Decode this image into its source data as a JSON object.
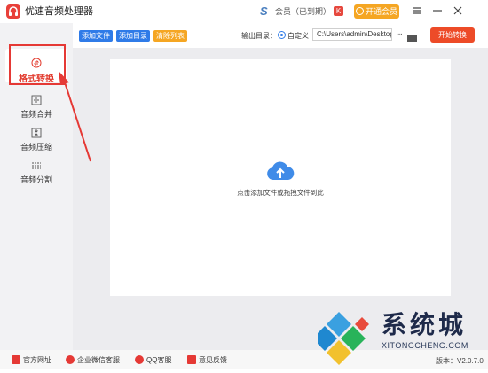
{
  "window": {
    "title": "优速音频处理器",
    "user_name": "会员（已到期）",
    "vip_button": "开通会员"
  },
  "sidebar": {
    "items": [
      {
        "label": "格式转换",
        "icon": "format-convert-icon",
        "active": true
      },
      {
        "label": "音频合并",
        "icon": "merge-icon",
        "active": false
      },
      {
        "label": "音频压缩",
        "icon": "compress-icon",
        "active": false
      },
      {
        "label": "音频分割",
        "icon": "split-icon",
        "active": false
      }
    ]
  },
  "toolbar": {
    "add_file": "添加文件",
    "add_folder": "添加目录",
    "clear_list": "清除列表",
    "output_label": "输出目录：",
    "custom_label": "自定义",
    "output_path": "C:\\Users\\admin\\Desktop",
    "more": "···",
    "start": "开始转换"
  },
  "main": {
    "drop_hint": "点击添加文件或拖拽文件到此"
  },
  "footer": {
    "website": "官方网址",
    "wechat": "企业微信客服",
    "qq": "QQ客服",
    "feedback": "意见反馈",
    "version": "版本：V2.0.7.0"
  },
  "watermark": {
    "title": "系统城",
    "subtitle": "XITONGCHENG.COM"
  },
  "colors": {
    "accent_red": "#e23b2e",
    "accent_blue": "#2f7be8",
    "start_button": "#ed4b28",
    "vip": "#f5a623",
    "clear_button": "#f5a623"
  }
}
